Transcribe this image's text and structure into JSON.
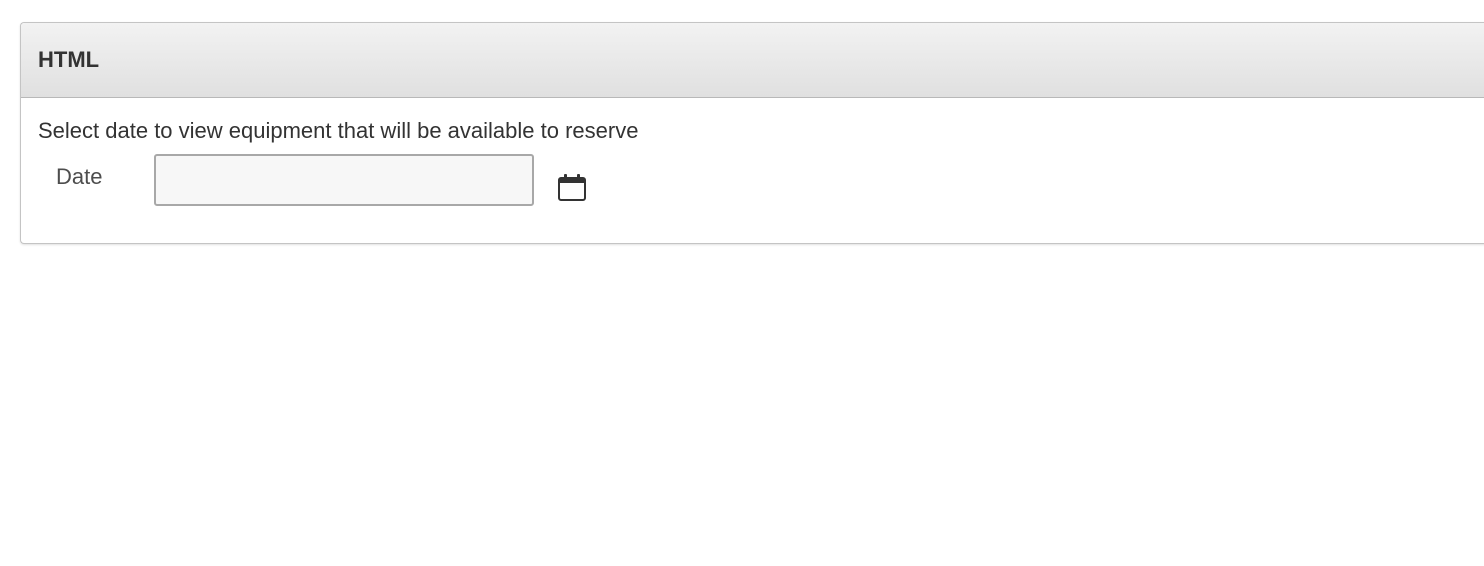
{
  "region": {
    "title": "HTML",
    "instructions": "Select date to view equipment that will be available to reserve"
  },
  "form": {
    "date_label": "Date",
    "date_value": "",
    "date_placeholder": "",
    "calendar_icon": "calendar-icon"
  }
}
